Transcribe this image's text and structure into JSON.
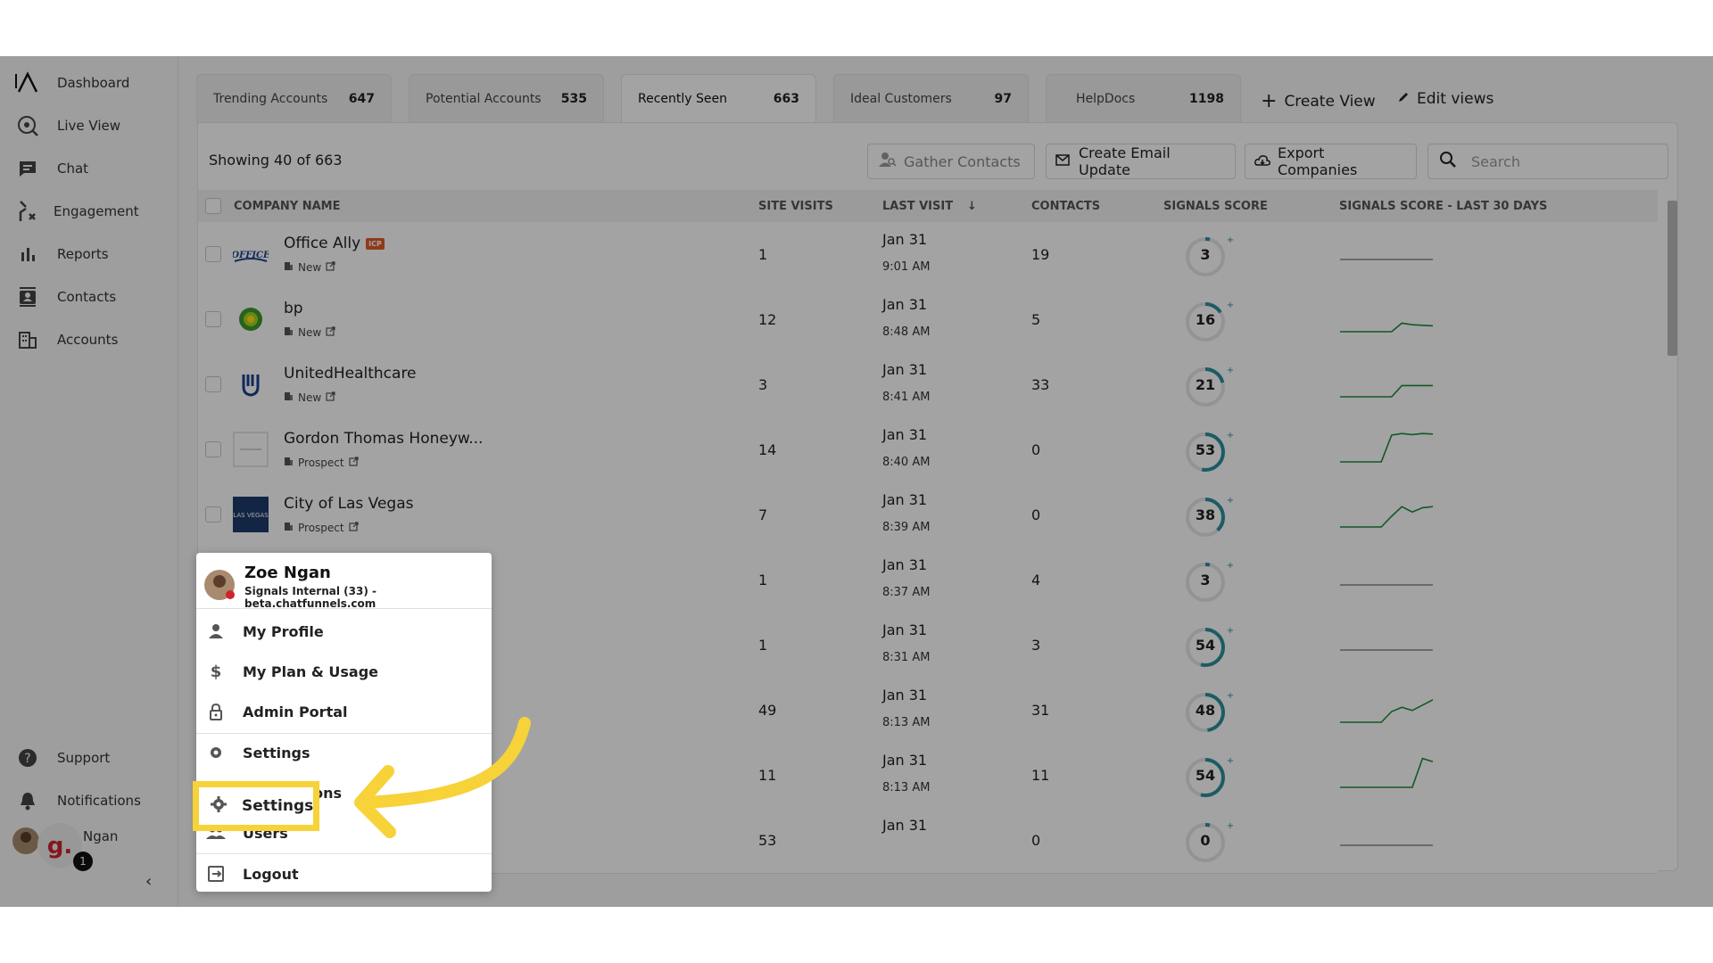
{
  "sidebar": {
    "items": [
      {
        "label": "Dashboard",
        "icon": "logo-icon"
      },
      {
        "label": "Live View",
        "icon": "live-view-icon"
      },
      {
        "label": "Chat",
        "icon": "chat-icon"
      },
      {
        "label": "Engagement",
        "icon": "engagement-icon"
      },
      {
        "label": "Reports",
        "icon": "bar-chart-icon"
      },
      {
        "label": "Contacts",
        "icon": "contacts-icon"
      },
      {
        "label": "Accounts",
        "icon": "building-icon"
      }
    ],
    "bottom": [
      {
        "label": "Support",
        "icon": "help-icon"
      },
      {
        "label": "Notifications",
        "icon": "bell-icon"
      }
    ],
    "user_label": "Ngan",
    "user_badge": "1",
    "collapse_icon": "chevron-left-icon",
    "collapse_glyph": "‹"
  },
  "tabs": [
    {
      "label": "Trending Accounts",
      "count": "647"
    },
    {
      "label": "Potential Accounts",
      "count": "535"
    },
    {
      "label": "Recently Seen",
      "count": "663"
    },
    {
      "label": "Ideal Customers",
      "count": "97"
    },
    {
      "label": "HelpDocs",
      "count": "1198"
    }
  ],
  "actions": {
    "create_view": "Create View",
    "edit_views": "Edit views",
    "create_glyph": "+"
  },
  "toolbar": {
    "showing": "Showing 40 of  663",
    "gather": "Gather Contacts",
    "email": "Create Email Update",
    "export": "Export Companies",
    "search_placeholder": "Search"
  },
  "table": {
    "headers": {
      "company": "COMPANY NAME",
      "visits": "SITE VISITS",
      "last_visit": "LAST VISIT",
      "sort_glyph": "↓",
      "contacts": "CONTACTS",
      "score": "SIGNALS SCORE",
      "trend": "SIGNALS SCORE - LAST 30 DAYS"
    },
    "rows": [
      {
        "name": "Office Ally",
        "icp": "ICP",
        "stage": "New",
        "visits": "1",
        "date": "Jan 31",
        "time": "9:01 AM",
        "contacts": "19",
        "score": "3",
        "score_fraction": 0.03,
        "trend": [
          0,
          0,
          0,
          0,
          0,
          0,
          0,
          0,
          0,
          0
        ],
        "logo": "office-ally-logo"
      },
      {
        "name": "bp",
        "icp": "",
        "stage": "New",
        "visits": "12",
        "date": "Jan 31",
        "time": "8:48 AM",
        "contacts": "5",
        "score": "16",
        "score_fraction": 0.16,
        "trend": [
          0,
          0,
          0,
          0,
          0,
          0,
          16,
          13,
          12,
          11
        ],
        "logo": "bp-logo"
      },
      {
        "name": "UnitedHealthcare",
        "icp": "",
        "stage": "New",
        "visits": "3",
        "date": "Jan 31",
        "time": "8:41 AM",
        "contacts": "33",
        "score": "21",
        "score_fraction": 0.21,
        "trend": [
          0,
          0,
          0,
          0,
          0,
          0,
          21,
          21,
          21,
          21
        ],
        "logo": "unitedhealthcare-logo"
      },
      {
        "name": "Gordon Thomas Honeyw...",
        "icp": "",
        "stage": "Prospect",
        "visits": "14",
        "date": "Jan 31",
        "time": "8:40 AM",
        "contacts": "0",
        "score": "53",
        "score_fraction": 0.53,
        "trend": [
          0,
          0,
          0,
          0,
          0,
          50,
          53,
          51,
          53,
          52
        ],
        "logo": "gordon-thomas-logo"
      },
      {
        "name": "City of Las Vegas",
        "icp": "",
        "stage": "Prospect",
        "visits": "7",
        "date": "Jan 31",
        "time": "8:39 AM",
        "contacts": "0",
        "score": "38",
        "score_fraction": 0.38,
        "trend": [
          0,
          0,
          0,
          0,
          0,
          20,
          38,
          28,
          36,
          38
        ],
        "logo": "las-vegas-logo"
      },
      {
        "name": "",
        "icp": "",
        "stage": "",
        "visits": "1",
        "date": "Jan 31",
        "time": "8:37 AM",
        "contacts": "4",
        "score": "3",
        "score_fraction": 0.03,
        "trend": [
          0,
          0,
          0,
          0,
          0,
          0,
          0,
          0,
          0,
          0
        ],
        "logo": ""
      },
      {
        "name": "",
        "icp": "",
        "stage": "",
        "visits": "1",
        "date": "Jan 31",
        "time": "8:31 AM",
        "contacts": "3",
        "score": "54",
        "score_fraction": 0.54,
        "trend": [
          0,
          0,
          0,
          0,
          0,
          0,
          0,
          0,
          0,
          0
        ],
        "logo": ""
      },
      {
        "name": "",
        "icp": "",
        "stage": "",
        "visits": "49",
        "date": "Jan 31",
        "time": "8:13 AM",
        "contacts": "31",
        "score": "48",
        "score_fraction": 0.48,
        "trend": [
          0,
          0,
          0,
          0,
          0,
          20,
          28,
          22,
          32,
          42
        ],
        "logo": ""
      },
      {
        "name": "",
        "icp": "",
        "stage": "",
        "visits": "11",
        "date": "Jan 31",
        "time": "8:13 AM",
        "contacts": "11",
        "score": "54",
        "score_fraction": 0.54,
        "trend": [
          0,
          0,
          0,
          0,
          0,
          0,
          0,
          0,
          54,
          48
        ],
        "logo": ""
      },
      {
        "name": "",
        "icp": "",
        "stage": "",
        "visits": "53",
        "date": "Jan 31",
        "time": "",
        "contacts": "0",
        "score": "0",
        "score_fraction": 0.0,
        "trend": [
          0,
          0,
          0,
          0,
          0,
          0,
          0,
          0,
          0,
          0
        ],
        "logo": ""
      }
    ]
  },
  "menu": {
    "user_name": "Zoe Ngan",
    "org": "Signals Internal (33) - beta.chatfunnels.com",
    "items": [
      {
        "label": "My Profile",
        "icon": "person-icon"
      },
      {
        "label": "My Plan & Usage",
        "icon": "dollar-icon"
      },
      {
        "label": "Admin Portal",
        "icon": "lock-icon"
      },
      {
        "label": "Settings",
        "icon": "gear-icon"
      },
      {
        "label": "Integrations",
        "icon": "integrations-icon"
      },
      {
        "label": "Users",
        "icon": "users-icon"
      },
      {
        "label": "Logout",
        "icon": "logout-icon"
      }
    ]
  },
  "colors": {
    "accent": "#2e8fa0",
    "sparkline": "#1d8a3a",
    "highlight": "#f7d238",
    "icp_badge": "#e25b2a"
  }
}
